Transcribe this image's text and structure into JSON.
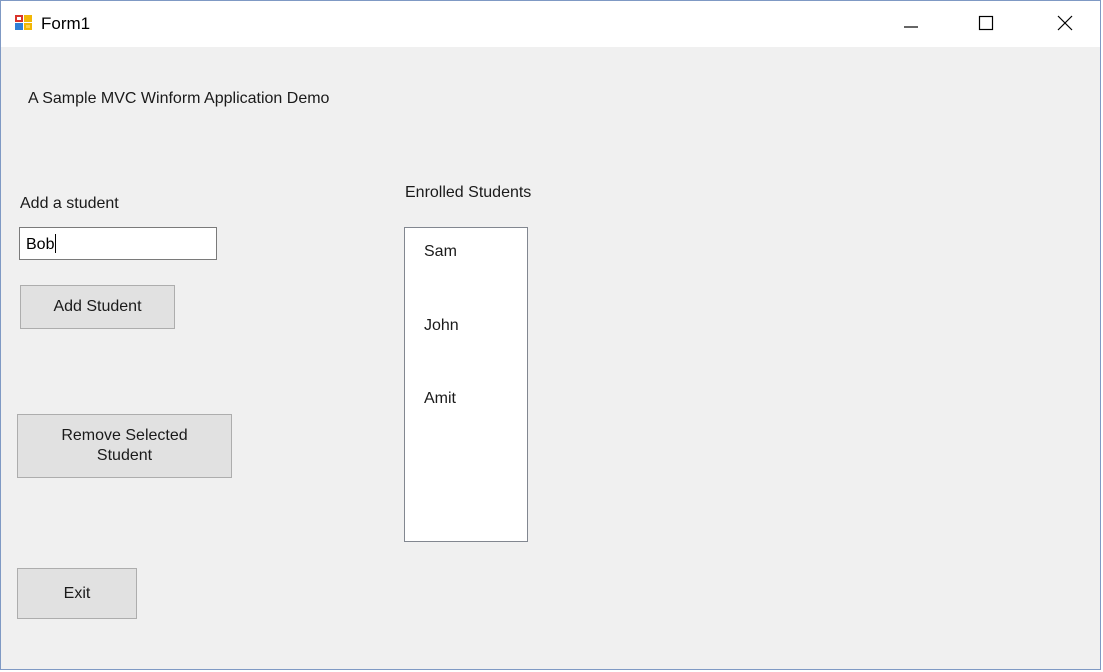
{
  "window": {
    "title": "Form1",
    "icon": "winforms-app-icon",
    "controls": {
      "minimize_icon": "minimize-icon",
      "maximize_icon": "maximize-icon",
      "close_icon": "close-icon"
    }
  },
  "form": {
    "heading": "A Sample MVC Winform Application Demo",
    "add_label": "Add a student",
    "student_input_value": "Bob",
    "add_button_label": "Add Student",
    "remove_button_label": "Remove Selected Student",
    "exit_button_label": "Exit",
    "enrolled_label": "Enrolled Students",
    "enrolled_students": [
      "Sam",
      "John",
      "Amit"
    ]
  }
}
